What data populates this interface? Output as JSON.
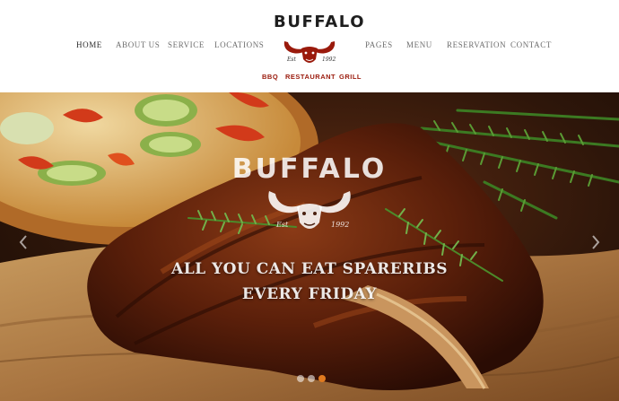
{
  "brand": {
    "logo_text": "BUFFALO",
    "est_left": "Est",
    "est_right": "1992"
  },
  "nav": {
    "left": [
      {
        "label": "HOME",
        "active": true
      },
      {
        "label": "ABOUT US"
      },
      {
        "label": "SERVICE"
      },
      {
        "label": "LOCATIONS"
      }
    ],
    "right": [
      {
        "label": "PAGES"
      },
      {
        "label": "MENU"
      },
      {
        "label": "RESERVATION"
      },
      {
        "label": "CONTACT"
      }
    ]
  },
  "tagline": [
    "BBQ",
    "RESTAURANT",
    "GRILL"
  ],
  "hero": {
    "brand": "BUFFALO",
    "est_left": "Est",
    "est_right": "1992",
    "headline_line1": "ALL YOU CAN EAT SPARERIBS",
    "headline_line2": "EVERY FRIDAY",
    "slides_total": 3,
    "active_slide": 3
  },
  "colors": {
    "accent": "#9a1a0c",
    "dot_active": "#e07a1f"
  },
  "icons": {
    "prev": "chevron-left-icon",
    "next": "chevron-right-icon"
  }
}
